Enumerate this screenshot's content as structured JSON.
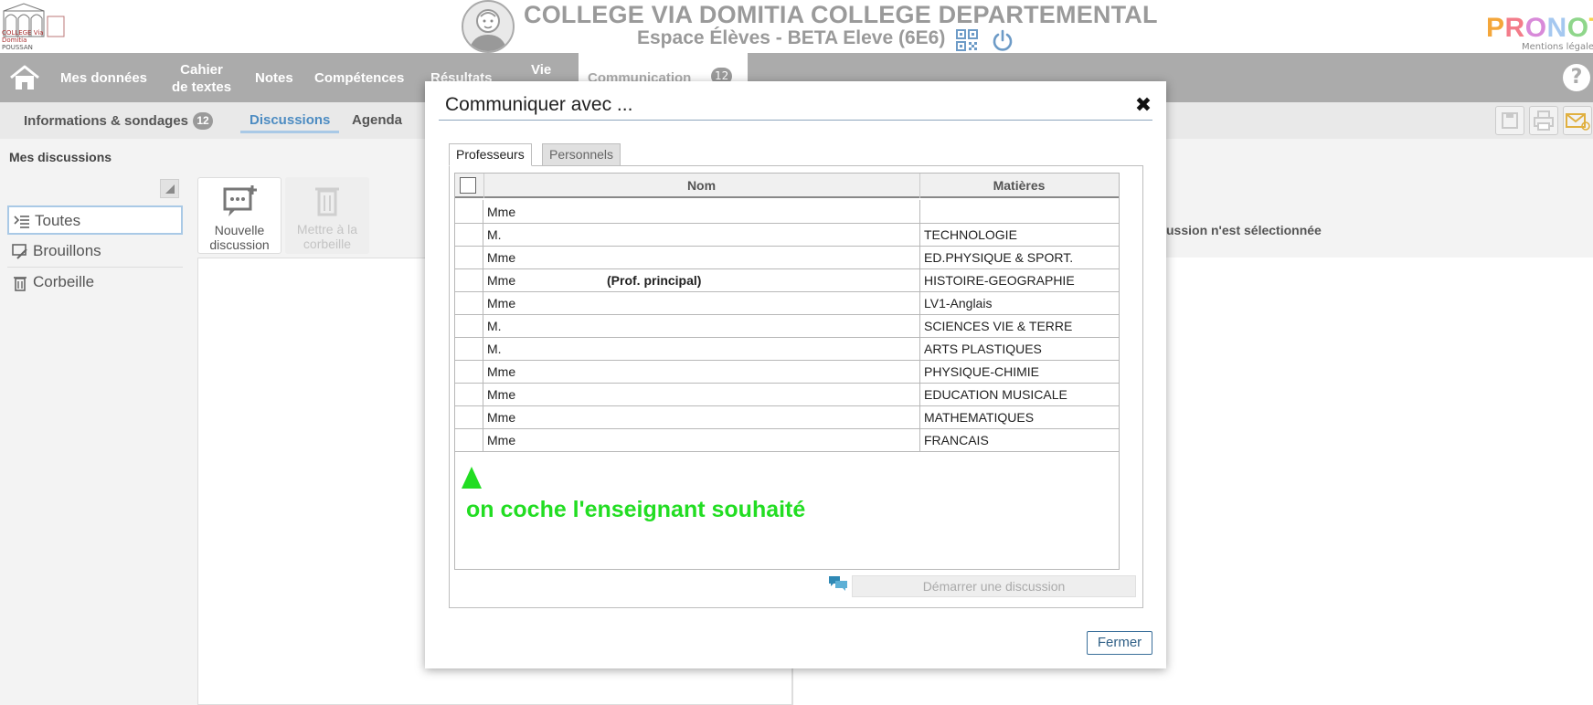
{
  "header": {
    "school_logo_caption_1": "COLLEGE Via Domitia",
    "school_logo_caption_2": "POUSSAN",
    "school_title": "COLLEGE VIA DOMITIA COLLEGE DEPARTEMENTAL",
    "space_title": "Espace Élèves - BETA Eleve (6E6)",
    "pronote_logo": "PRONOTE",
    "mentions": "Mentions légales",
    "pronote_colors": [
      "#f4a63a",
      "#f37c8a",
      "#d88ad9",
      "#a5c8f0",
      "#8fd68b",
      "#f6d34b",
      "#f28b4b"
    ]
  },
  "nav": {
    "items": [
      "Mes données",
      "Cahier\nde textes",
      "Notes",
      "Compétences",
      "Résultats",
      "Vie"
    ],
    "active": "Communication",
    "active_count": "12",
    "help": "?"
  },
  "subnav": {
    "info": "Informations & sondages",
    "info_count": "12",
    "discussions": "Discussions",
    "agenda": "Agenda"
  },
  "left": {
    "title": "Mes discussions",
    "folders": [
      "Toutes",
      "Brouillons",
      "Corbeille"
    ],
    "new_discussion": "Nouvelle\ndiscussion",
    "trash": "Mettre à la\ncorbeille",
    "no_selection": "ussion n'est sélectionnée"
  },
  "modal": {
    "title": "Communiquer avec ...",
    "close_glyph": "✖",
    "tabs": [
      "Professeurs",
      "Personnels"
    ],
    "columns": {
      "name": "Nom",
      "subject": "Matières"
    },
    "rows": [
      {
        "civility": "Mme",
        "note": "",
        "subject": ""
      },
      {
        "civility": "M.",
        "note": "",
        "subject": "TECHNOLOGIE"
      },
      {
        "civility": "Mme",
        "note": "",
        "subject": "ED.PHYSIQUE & SPORT."
      },
      {
        "civility": "Mme",
        "note": "(Prof. principal)",
        "subject": "HISTOIRE-GEOGRAPHIE"
      },
      {
        "civility": "Mme",
        "note": "",
        "subject": "LV1-Anglais"
      },
      {
        "civility": "M.",
        "note": "",
        "subject": "SCIENCES VIE & TERRE"
      },
      {
        "civility": "M.",
        "note": "",
        "subject": "ARTS PLASTIQUES"
      },
      {
        "civility": "Mme",
        "note": "",
        "subject": "PHYSIQUE-CHIMIE"
      },
      {
        "civility": "Mme",
        "note": "",
        "subject": "EDUCATION MUSICALE"
      },
      {
        "civility": "Mme",
        "note": "",
        "subject": "MATHEMATIQUES"
      },
      {
        "civility": "Mme",
        "note": "",
        "subject": "FRANCAIS"
      }
    ],
    "annotation": "on coche l'enseignant souhaité",
    "annotation_color": "#22dd22",
    "start_button": "Démarrer une discussion",
    "close_button": "Fermer"
  }
}
